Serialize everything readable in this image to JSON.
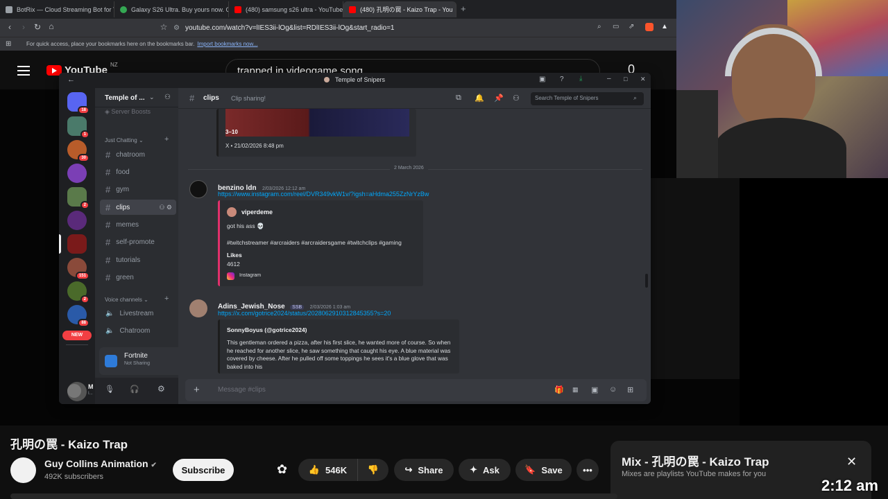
{
  "browser": {
    "tabs": [
      {
        "title": "BotRix — Cloud Streaming Bot for Tw",
        "color": "#9aa0a6"
      },
      {
        "title": "Galaxy S26 Ultra. Buy yours now. One",
        "color": "#34a853"
      },
      {
        "title": "(480) samsung s26 ultra - YouTube",
        "color": "#ff0000"
      },
      {
        "title": "(480) 孔明の罠 - Kaizo Trap - You",
        "color": "#ff0000"
      }
    ],
    "url": "youtube.com/watch?v=lIES3ii-lOg&list=RDlIES3ii-lOg&start_radio=1",
    "bookmarks_text": "For quick access, place your bookmarks here on the bookmarks bar.",
    "bookmarks_link": "Import bookmarks now..."
  },
  "youtube": {
    "logo": "YouTube",
    "region": "NZ",
    "search_value": "trapped in videogame song",
    "notif_count": "0",
    "video_title": "孔明の罠 - Kaizo Trap",
    "channel_name": "Guy Collins Animation",
    "subscribers": "492K subscribers",
    "subscribe": "Subscribe",
    "likes": "546K",
    "share": "Share",
    "ask": "Ask",
    "save": "Save",
    "mix_title": "Mix - 孔明の罠 - Kaizo Trap",
    "mix_sub": "Mixes are playlists YouTube makes for you"
  },
  "overlay_clock": "2:12 am",
  "discord": {
    "window_title": "Temple of Snipers",
    "server_name": "Temple of ...",
    "server_boosts": "Server Boosts",
    "home_badge": "18",
    "server_badges": [
      "1",
      "30",
      "",
      "2",
      "",
      "",
      "151",
      "2",
      "88"
    ],
    "new_label": "NEW",
    "text_category": "Just Chatting",
    "channels": [
      "chatroom",
      "food",
      "gym",
      "clips",
      "memes",
      "self-promote",
      "tutorials",
      "green"
    ],
    "voice_category": "Voice channels",
    "voice_channels": [
      "Livestream",
      "Chatroom"
    ],
    "activity_game": "Fortnite",
    "activity_status": "Not Sharing",
    "user_initial": "M",
    "user_status": "I...",
    "channel_header": "clips",
    "channel_topic": "Clip sharing!",
    "search_placeholder": "Search Temple of Snipers",
    "prev_embed_text": "3–10",
    "prev_embed_source": "X • 21/02/2026 8:48 pm",
    "date_divider": "2 March 2026",
    "messages": [
      {
        "author": "benzino ldn",
        "time": "2/03/2026 12:12 am",
        "link": "https://www.instagram.com/reel/DVR349vkW1v/?igsh=aHdma255ZzNrYzBw",
        "embed_author": "viperdeme",
        "embed_line1": "got his ass 💀",
        "embed_line2": "#twitchstreamer #arcraiders #arcraidersgame #twitchclips #gaming",
        "embed_field_name": "Likes",
        "embed_field_value": "4612",
        "embed_footer": "Instagram"
      },
      {
        "author": "Adins_Jewish_Nose",
        "tag": "SSB",
        "time": "2/03/2026 1:03 am",
        "link": "https://x.com/gotrice2024/status/2028062910312845355?s=20",
        "embed_author": "SonnyBoyus (@gotrice2024)",
        "embed_text": "This gentleman ordered a pizza, after his first slice, he wanted more of course. So when he reached for another slice, he saw something that caught his eye. A blue material was covered by cheese. After he pulled off some toppings he sees it's a blue glove that was baked into his"
      }
    ],
    "composer_placeholder": "Message #clips"
  },
  "colors": {
    "discord_bg": "#313338",
    "discord_sidebar": "#2b2d31",
    "discord_rail": "#1e1f22",
    "link": "#00a8fc",
    "yt_red": "#ff0000"
  }
}
